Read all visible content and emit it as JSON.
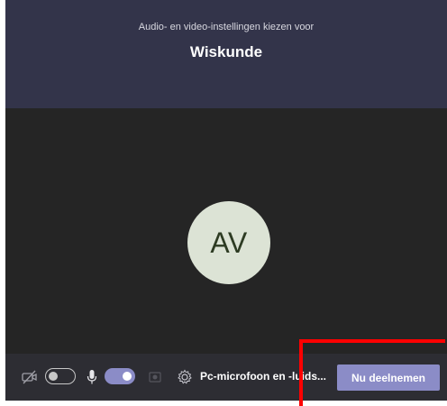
{
  "header": {
    "subtitle": "Audio- en video-instellingen kiezen voor",
    "title": "Wiskunde"
  },
  "avatar": {
    "initials": "AV"
  },
  "controls": {
    "camera_icon": "camera-off-icon",
    "camera_toggle_on": false,
    "mic_icon": "microphone-icon",
    "mic_toggle_on": true,
    "blur_icon": "background-blur-icon",
    "settings_icon": "gear-icon",
    "device_label": "Pc-microfoon en -luids...",
    "join_label": "Nu deelnemen"
  },
  "colors": {
    "header_bg": "#33344a",
    "stage_bg": "#252525",
    "controls_bg": "#2d2d33",
    "accent": "#8b8cc7",
    "avatar_bg": "#dce3d5",
    "highlight": "#ff0000"
  }
}
